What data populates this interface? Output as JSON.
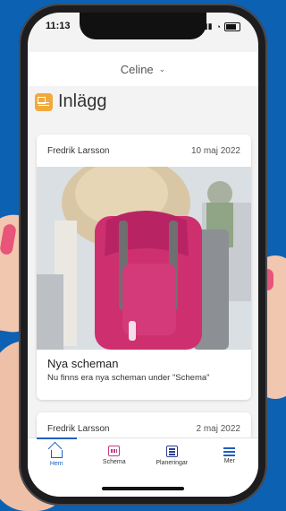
{
  "status_bar": {
    "time": "11:13",
    "signal": "▮▮▮",
    "wifi": "◔"
  },
  "header": {
    "user_name": "Celine",
    "chevron": "⌄"
  },
  "page": {
    "title": "Inlägg",
    "title_icon": "newspaper-icon",
    "accent": "#f2a93b"
  },
  "posts": [
    {
      "author": "Fredrik Larsson",
      "date": "10 maj 2022",
      "image": "photo-pink-backpack",
      "title": "Nya scheman",
      "text": "Nu finns era nya scheman under \"Schema\""
    },
    {
      "author": "Fredrik Larsson",
      "date": "2 maj 2022"
    }
  ],
  "nav": [
    {
      "label": "Hem",
      "icon": "home-icon",
      "active": true,
      "color": "#1f5fc0"
    },
    {
      "label": "Schema",
      "icon": "calendar-icon",
      "active": false,
      "color": "#c23a84"
    },
    {
      "label": "Planeringar",
      "icon": "list-icon",
      "active": false,
      "color": "#2a3d8f"
    },
    {
      "label": "Mer",
      "icon": "menu-icon",
      "active": false,
      "color": "#1f5fc0"
    }
  ]
}
